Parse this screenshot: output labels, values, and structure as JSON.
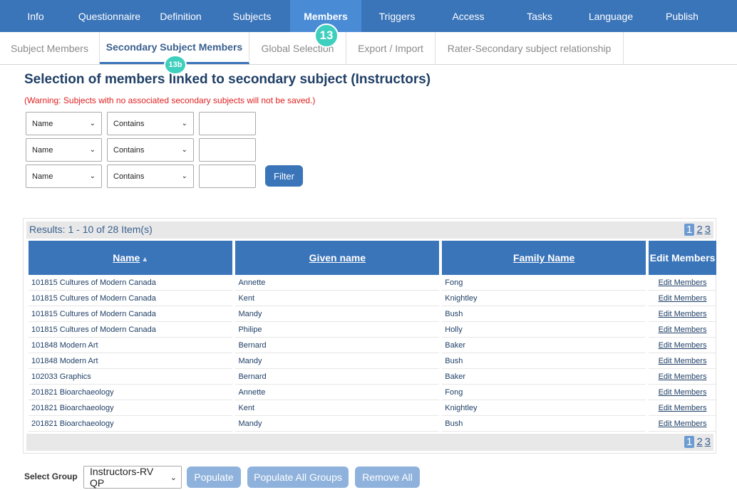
{
  "nav": {
    "tabs": [
      {
        "label": "Info"
      },
      {
        "label": "Questionnaire"
      },
      {
        "label": "Definition"
      },
      {
        "label": "Subjects"
      },
      {
        "label": "Members"
      },
      {
        "label": "Triggers"
      },
      {
        "label": "Access"
      },
      {
        "label": "Tasks"
      },
      {
        "label": "Language"
      },
      {
        "label": "Publish"
      }
    ],
    "active": "Members"
  },
  "subnav": {
    "tabs": [
      {
        "label": "Subject Members"
      },
      {
        "label": "Secondary Subject Members"
      },
      {
        "label": "Global Selection"
      },
      {
        "label": "Export / Import"
      },
      {
        "label": "Rater-Secondary subject relationship"
      }
    ],
    "active": "Secondary Subject Members"
  },
  "badges": {
    "members": "13",
    "secondary": "13b"
  },
  "page": {
    "title": "Selection of members linked to secondary subject (Instructors)",
    "warning": "(Warning: Subjects with no associated secondary subjects will not be saved.)"
  },
  "filters": [
    {
      "field": "Name",
      "operator": "Contains",
      "value": ""
    },
    {
      "field": "Name",
      "operator": "Contains",
      "value": ""
    },
    {
      "field": "Name",
      "operator": "Contains",
      "value": ""
    }
  ],
  "filter_button": "Filter",
  "results": {
    "summary": "Results: 1 - 10 of 28 Item(s)",
    "pages": [
      "1",
      "2",
      "3"
    ],
    "current_page": "1"
  },
  "table": {
    "columns": [
      "Name",
      "Given name",
      "Family Name",
      "Edit Members"
    ],
    "rows": [
      [
        "101815 Cultures of Modern Canada",
        "Annette",
        "Fong",
        "Edit Members"
      ],
      [
        "101815 Cultures of Modern Canada",
        "Kent",
        "Knightley",
        "Edit Members"
      ],
      [
        "101815 Cultures of Modern Canada",
        "Mandy",
        "Bush",
        "Edit Members"
      ],
      [
        "101815 Cultures of Modern Canada",
        "Philipe",
        "Holly",
        "Edit Members"
      ],
      [
        "101848 Modern Art",
        "Bernard",
        "Baker",
        "Edit Members"
      ],
      [
        "101848 Modern Art",
        "Mandy",
        "Bush",
        "Edit Members"
      ],
      [
        "102033 Graphics",
        "Bernard",
        "Baker",
        "Edit Members"
      ],
      [
        "201821 Bioarchaeology",
        "Annette",
        "Fong",
        "Edit Members"
      ],
      [
        "201821 Bioarchaeology",
        "Kent",
        "Knightley",
        "Edit Members"
      ],
      [
        "201821 Bioarchaeology",
        "Mandy",
        "Bush",
        "Edit Members"
      ]
    ]
  },
  "bottom": {
    "select_group_label": "Select Group",
    "group_value": "Instructors-RV QP",
    "populate": "Populate",
    "populate_all": "Populate All Groups",
    "remove_all": "Remove All"
  },
  "colors": {
    "nav": "#3a74b9",
    "nav_active": "#4a8bd6",
    "badge": "#3ecfbe",
    "warning": "#e02020",
    "button_disabled": "#8fb2dc"
  }
}
